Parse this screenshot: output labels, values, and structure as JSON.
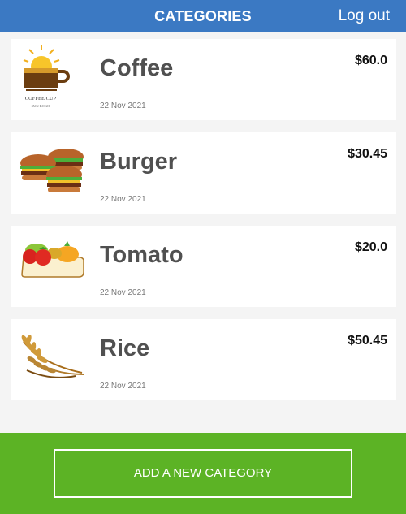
{
  "header": {
    "title": "CATEGORIES",
    "logout_label": "Log out"
  },
  "categories": [
    {
      "name": "Coffee",
      "date": "22 Nov 2021",
      "price": "$60.0",
      "icon": "coffee-cup-logo",
      "logo_text": "COFFEE CUP",
      "logo_subtext": "SUN LOGO"
    },
    {
      "name": "Burger",
      "date": "22 Nov 2021",
      "price": "$30.45",
      "icon": "burgers"
    },
    {
      "name": "Tomato",
      "date": "22 Nov 2021",
      "price": "$20.0",
      "icon": "vegetables-basket"
    },
    {
      "name": "Rice",
      "date": "22 Nov 2021",
      "price": "$50.45",
      "icon": "wheat-stalks"
    }
  ],
  "footer": {
    "add_button_label": "ADD A NEW CATEGORY"
  },
  "colors": {
    "header_bg": "#3b79c3",
    "footer_bg": "#5cb325",
    "background": "#f4f4f4"
  }
}
